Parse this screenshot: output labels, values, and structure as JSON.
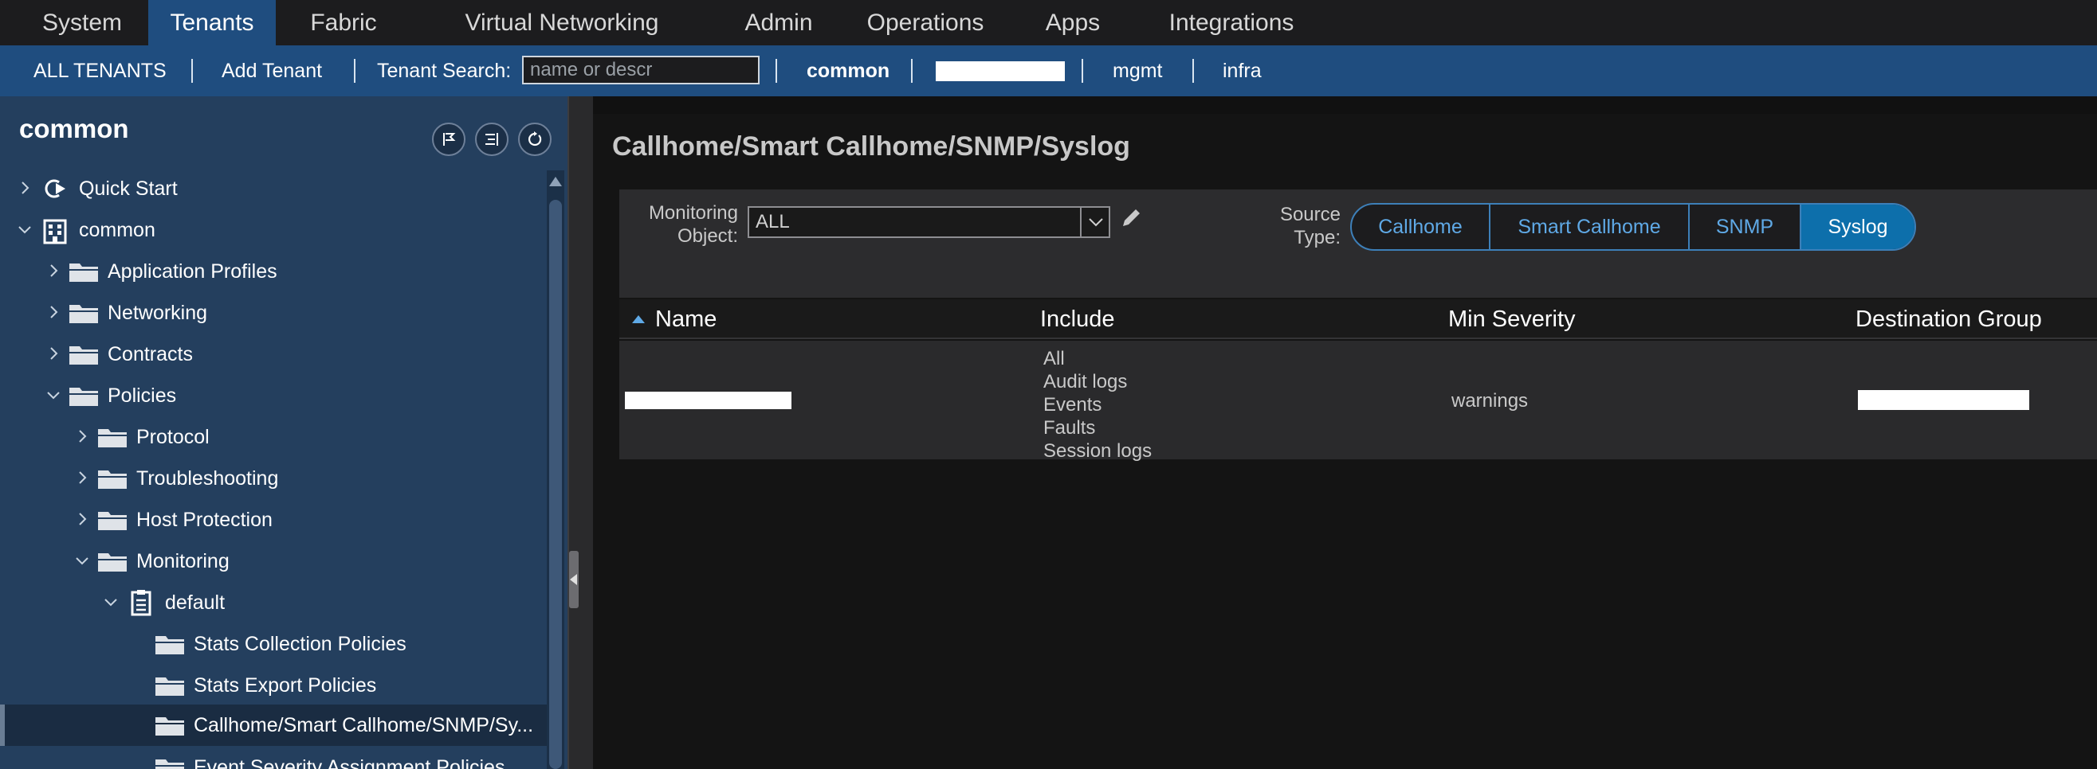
{
  "topbar": {
    "tabs": [
      {
        "label": "System",
        "active": false
      },
      {
        "label": "Tenants",
        "active": true
      },
      {
        "label": "Fabric",
        "active": false
      },
      {
        "label": "Virtual Networking",
        "active": false
      },
      {
        "label": "Admin",
        "active": false
      },
      {
        "label": "Operations",
        "active": false
      },
      {
        "label": "Apps",
        "active": false
      },
      {
        "label": "Integrations",
        "active": false
      }
    ]
  },
  "tenantbar": {
    "all_tenants": "ALL TENANTS",
    "add_tenant": "Add Tenant",
    "search_label": "Tenant Search:",
    "search_placeholder": "name or descr",
    "tenants": [
      "common",
      "mgmt",
      "infra"
    ]
  },
  "sidebar": {
    "title": "common",
    "tree": [
      {
        "label": "Quick Start",
        "icon": "quick-start-icon",
        "expanded": false
      },
      {
        "label": "common",
        "icon": "tenant-building-icon",
        "expanded": true
      },
      {
        "label": "Application Profiles",
        "icon": "folder-icon",
        "expanded": false
      },
      {
        "label": "Networking",
        "icon": "folder-icon",
        "expanded": false
      },
      {
        "label": "Contracts",
        "icon": "folder-icon",
        "expanded": false
      },
      {
        "label": "Policies",
        "icon": "folder-icon",
        "expanded": true
      },
      {
        "label": "Protocol",
        "icon": "folder-icon",
        "expanded": false
      },
      {
        "label": "Troubleshooting",
        "icon": "folder-icon",
        "expanded": false
      },
      {
        "label": "Host Protection",
        "icon": "folder-icon",
        "expanded": false
      },
      {
        "label": "Monitoring",
        "icon": "folder-icon",
        "expanded": true
      },
      {
        "label": "default",
        "icon": "policy-document-icon",
        "expanded": true
      },
      {
        "label": "Stats Collection Policies",
        "icon": "folder-icon"
      },
      {
        "label": "Stats Export Policies",
        "icon": "folder-icon"
      },
      {
        "label": "Callhome/Smart Callhome/SNMP/Sy...",
        "icon": "folder-icon",
        "selected": true
      },
      {
        "label": "Event Severity Assignment Policies",
        "icon": "folder-icon"
      }
    ]
  },
  "main": {
    "title": "Callhome/Smart Callhome/SNMP/Syslog",
    "monitoring_object_label": "Monitoring Object:",
    "monitoring_object_label_1": "Monitoring",
    "monitoring_object_label_2": "Object:",
    "monitoring_object_value": "ALL",
    "source_type_label_1": "Source",
    "source_type_label_2": "Type:",
    "source_types": [
      {
        "label": "Callhome",
        "active": false
      },
      {
        "label": "Smart Callhome",
        "active": false
      },
      {
        "label": "SNMP",
        "active": false
      },
      {
        "label": "Syslog",
        "active": true
      }
    ],
    "table": {
      "columns": [
        "Name",
        "Include",
        "Min Severity",
        "Destination Group"
      ],
      "rows": [
        {
          "include": [
            "All",
            "Audit logs",
            "Events",
            "Faults",
            "Session logs"
          ],
          "min_severity": "warnings"
        }
      ]
    }
  },
  "colors": {
    "tenant_bar": "#1f4d7f",
    "sidebar": "#243f5e",
    "accent": "#0d6fab",
    "link": "#5fa9e6"
  }
}
